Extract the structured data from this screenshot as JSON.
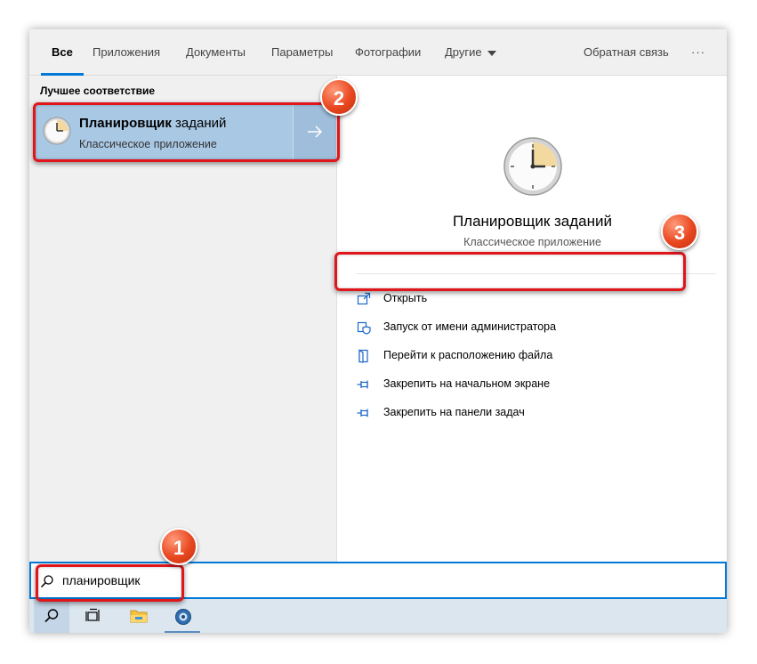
{
  "tabs": {
    "all": "Все",
    "apps": "Приложения",
    "documents": "Документы",
    "settings": "Параметры",
    "photos": "Фотографии",
    "other": "Другие",
    "feedback": "Обратная связь",
    "more": "···"
  },
  "left": {
    "section_title": "Лучшее соответствие",
    "result_name_bold": "Планировщик",
    "result_name_rest": " заданий",
    "result_type": "Классическое приложение"
  },
  "detail": {
    "name": "Планировщик заданий",
    "type": "Классическое приложение",
    "actions": [
      {
        "label": "Открыть",
        "icon": "open-icon"
      },
      {
        "label": "Запуск от имени администратора",
        "icon": "admin-shield-icon"
      },
      {
        "label": "Перейти к расположению файла",
        "icon": "file-location-icon"
      },
      {
        "label": "Закрепить на начальном экране",
        "icon": "pin-icon"
      },
      {
        "label": "Закрепить на панели задач",
        "icon": "pin-icon"
      }
    ]
  },
  "search": {
    "value": "планировщик"
  },
  "annotations": {
    "badge1": "1",
    "badge2": "2",
    "badge3": "3"
  },
  "colors": {
    "accent": "#0078d7",
    "selection": "#a9c8e4",
    "highlight": "#e0161b"
  },
  "taskbar": [
    "search-icon",
    "task-view-icon",
    "file-explorer-icon",
    "app-icon"
  ]
}
